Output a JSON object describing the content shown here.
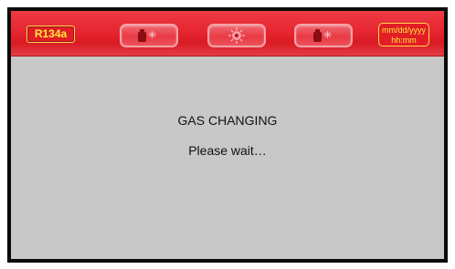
{
  "header": {
    "gas_type": "R134a",
    "datetime_line1": "mm/dd/yyyy",
    "datetime_line2": "hh:mm",
    "icons": [
      "gas-tank-left-icon",
      "recovery-cycle-icon",
      "gas-tank-right-icon"
    ]
  },
  "message": {
    "title": "GAS CHANGING",
    "subtitle": "Please wait…"
  },
  "colors": {
    "header_red": "#e62630",
    "label_text_yellow": "#ffeb3b",
    "screen_gray": "#c8c8c8",
    "bezel_black": "#0a0a0a"
  }
}
